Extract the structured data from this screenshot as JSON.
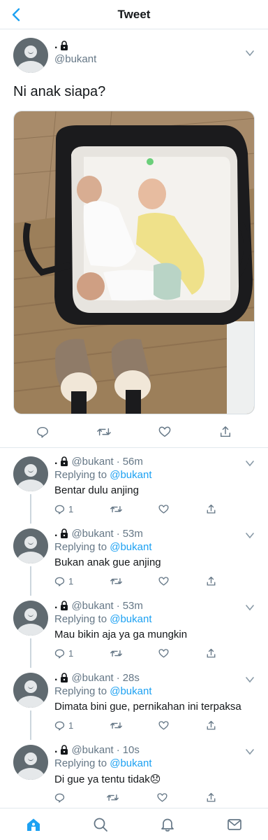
{
  "header": {
    "title": "Tweet"
  },
  "main_tweet": {
    "display_name": ".",
    "handle": "@bukant",
    "text": "Ni anak siapa?",
    "photo_alt": "Twin babies in a bassinet"
  },
  "replies": [
    {
      "display_name": ".",
      "handle": "@bukant",
      "time": "56m",
      "replying_label": "Replying to",
      "replying_to": "@bukant",
      "text": "Bentar dulu anjing",
      "reply_count": "1"
    },
    {
      "display_name": ".",
      "handle": "@bukant",
      "time": "53m",
      "replying_label": "Replying to",
      "replying_to": "@bukant",
      "text": "Bukan anak gue anjing",
      "reply_count": "1"
    },
    {
      "display_name": ".",
      "handle": "@bukant",
      "time": "53m",
      "replying_label": "Replying to",
      "replying_to": "@bukant",
      "text": "Mau bikin aja ya ga mungkin",
      "reply_count": "1"
    },
    {
      "display_name": ".",
      "handle": "@bukant",
      "time": "28s",
      "replying_label": "Replying to",
      "replying_to": "@bukant",
      "text": "Dimata bini gue, pernikahan ini terpaksa",
      "reply_count": "1"
    },
    {
      "display_name": ".",
      "handle": "@bukant",
      "time": "10s",
      "replying_label": "Replying to",
      "replying_to": "@bukant",
      "text": "Di gue ya tentu tidak😞",
      "reply_count": ""
    }
  ],
  "separator": "·",
  "icons": {
    "back": "chevron-left-icon",
    "lock": "lock-icon",
    "chevron": "chevron-down-icon",
    "reply": "reply-icon",
    "retweet": "retweet-icon",
    "like": "heart-icon",
    "share": "share-icon",
    "home": "home-icon",
    "search": "search-icon",
    "notifications": "bell-icon",
    "messages": "mail-icon"
  },
  "colors": {
    "accent": "#1da1f2",
    "secondary_text": "#657786",
    "border": "#e1e8ed"
  }
}
